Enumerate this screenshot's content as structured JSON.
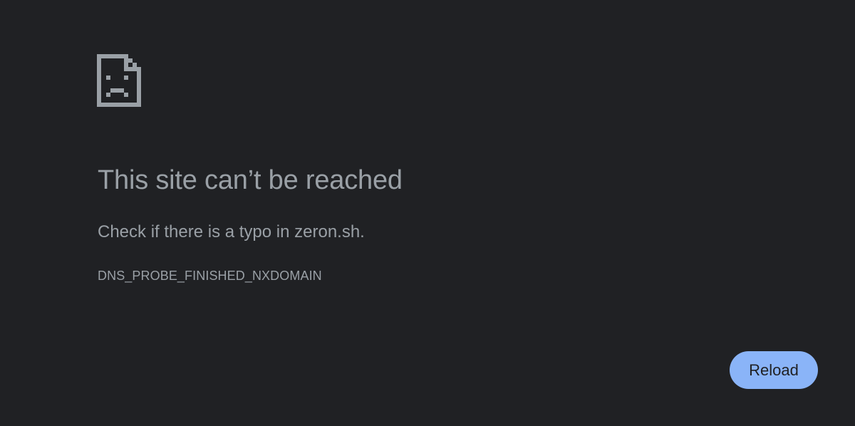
{
  "page": {
    "background_color": "#202124",
    "text_color": "#9aa0a6",
    "accent_color": "#8ab4f8"
  },
  "icon": {
    "name": "sad-page-icon"
  },
  "error": {
    "heading": "This site can’t be reached",
    "suggestion": "Check if there is a typo in zeron.sh.",
    "code": "DNS_PROBE_FINISHED_NXDOMAIN"
  },
  "actions": {
    "reload_label": "Reload"
  }
}
